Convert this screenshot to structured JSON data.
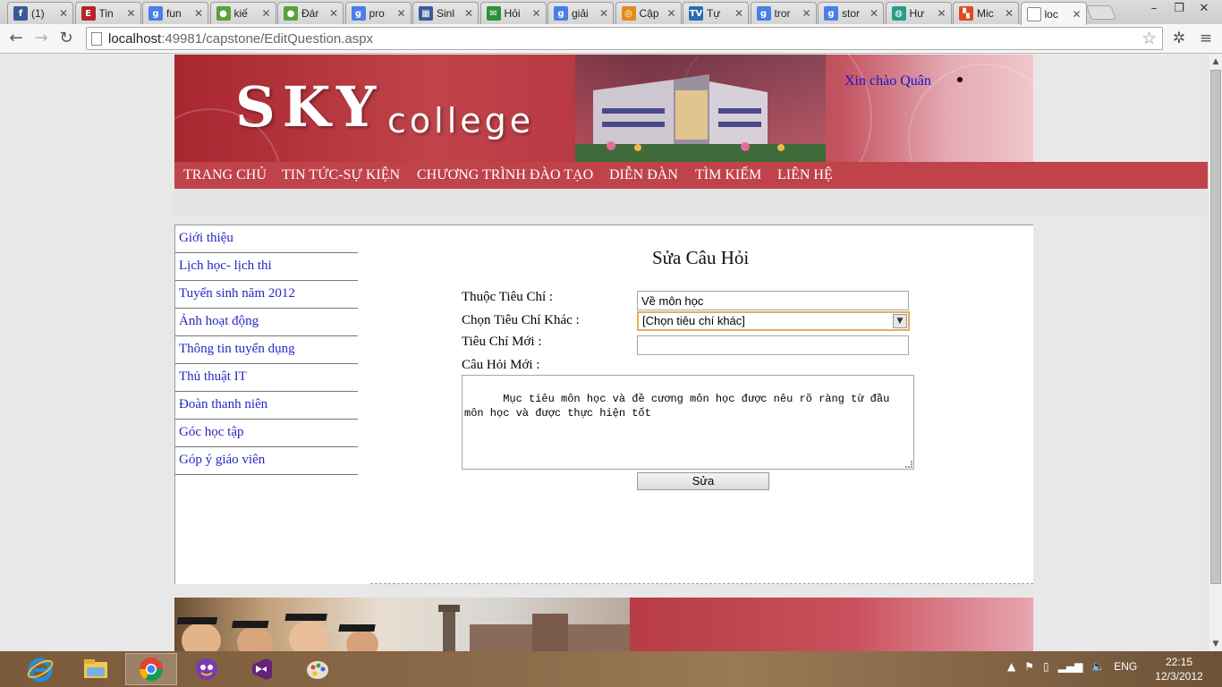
{
  "browser": {
    "tabs": [
      {
        "title": "(1)",
        "icon": "facebook-icon",
        "color": "#3b5998",
        "glyph": "f"
      },
      {
        "title": "Tin",
        "icon": "news-icon",
        "color": "#b3262b",
        "glyph": "E"
      },
      {
        "title": "fun",
        "icon": "google-search-icon",
        "color": "#4a7ee8",
        "glyph": "g"
      },
      {
        "title": "kiế",
        "icon": "coccoc-icon",
        "color": "#5aa03c",
        "glyph": "●"
      },
      {
        "title": "Đár",
        "icon": "coccoc-icon",
        "color": "#5aa03c",
        "glyph": "●"
      },
      {
        "title": "pro",
        "icon": "google-search-icon",
        "color": "#4a7ee8",
        "glyph": "g"
      },
      {
        "title": "Sinl",
        "icon": "table-icon",
        "color": "#3c5a99",
        "glyph": "▦"
      },
      {
        "title": "Hỏi",
        "icon": "forum-icon",
        "color": "#2f8f3a",
        "glyph": "✉"
      },
      {
        "title": "giải",
        "icon": "google-search-icon",
        "color": "#4a7ee8",
        "glyph": "g"
      },
      {
        "title": "Cập",
        "icon": "clock-icon",
        "color": "#e58a1a",
        "glyph": "◎"
      },
      {
        "title": "Tự",
        "icon": "tv-icon",
        "color": "#2a6fb3",
        "glyph": "TV"
      },
      {
        "title": "tror",
        "icon": "google-search-icon",
        "color": "#4a7ee8",
        "glyph": "g"
      },
      {
        "title": "stor",
        "icon": "google-search-icon",
        "color": "#4a7ee8",
        "glyph": "g"
      },
      {
        "title": "Hư",
        "icon": "globe-icon",
        "color": "#2a9a8a",
        "glyph": "◍"
      },
      {
        "title": "Mic",
        "icon": "microsoft-icon",
        "color": "#e04a1a",
        "glyph": "▚"
      },
      {
        "title": "loc",
        "icon": "page-icon",
        "color": "#ffffff",
        "glyph": "",
        "active": true
      }
    ],
    "url_host": "localhost",
    "url_path": ":49981/capstone/EditQuestion.aspx",
    "window_controls": [
      "–",
      "❐",
      "✕"
    ]
  },
  "site": {
    "logo_sky": "SKY",
    "logo_college": "college",
    "greeting": "Xin chào Quân",
    "nav": [
      "TRANG CHỦ",
      "TIN TỨC-SỰ KIỆN",
      "CHƯƠNG TRÌNH ĐÀO TẠO",
      "DIỄN ĐÀN",
      "TÌM KIẾM",
      "LIÊN HỆ"
    ],
    "sidebar": [
      "Giới thiệu",
      "Lịch học- lịch thi",
      "Tuyển sinh năm 2012",
      "Ảnh hoạt động",
      "Thông tin tuyển dụng",
      "Thủ thuật IT",
      "Đoàn thanh niên",
      "Góc học tập",
      "Góp ý giáo viên"
    ]
  },
  "form": {
    "title": "Sửa Câu Hỏi",
    "criteria_label": "Thuộc Tiêu Chí :",
    "criteria_value": "Về môn học",
    "other_label": "Chọn Tiêu Chí Khác :",
    "other_selected": "[Chọn tiêu chí khác]",
    "new_criteria_label": "Tiêu Chí Mới :",
    "new_criteria_value": "",
    "question_label": "Câu Hỏi Mới :",
    "question_value": "Mục tiêu môn học và đề cương môn học được nêu rõ ràng từ đầu môn học và được thực hiện tốt",
    "submit_label": "Sửa"
  },
  "taskbar": {
    "language": "ENG",
    "time": "22:15",
    "date": "12/3/2012",
    "apps": [
      "internet-explorer-icon",
      "file-explorer-icon",
      "chrome-icon",
      "messenger-icon",
      "visual-studio-icon",
      "paint-icon"
    ]
  }
}
